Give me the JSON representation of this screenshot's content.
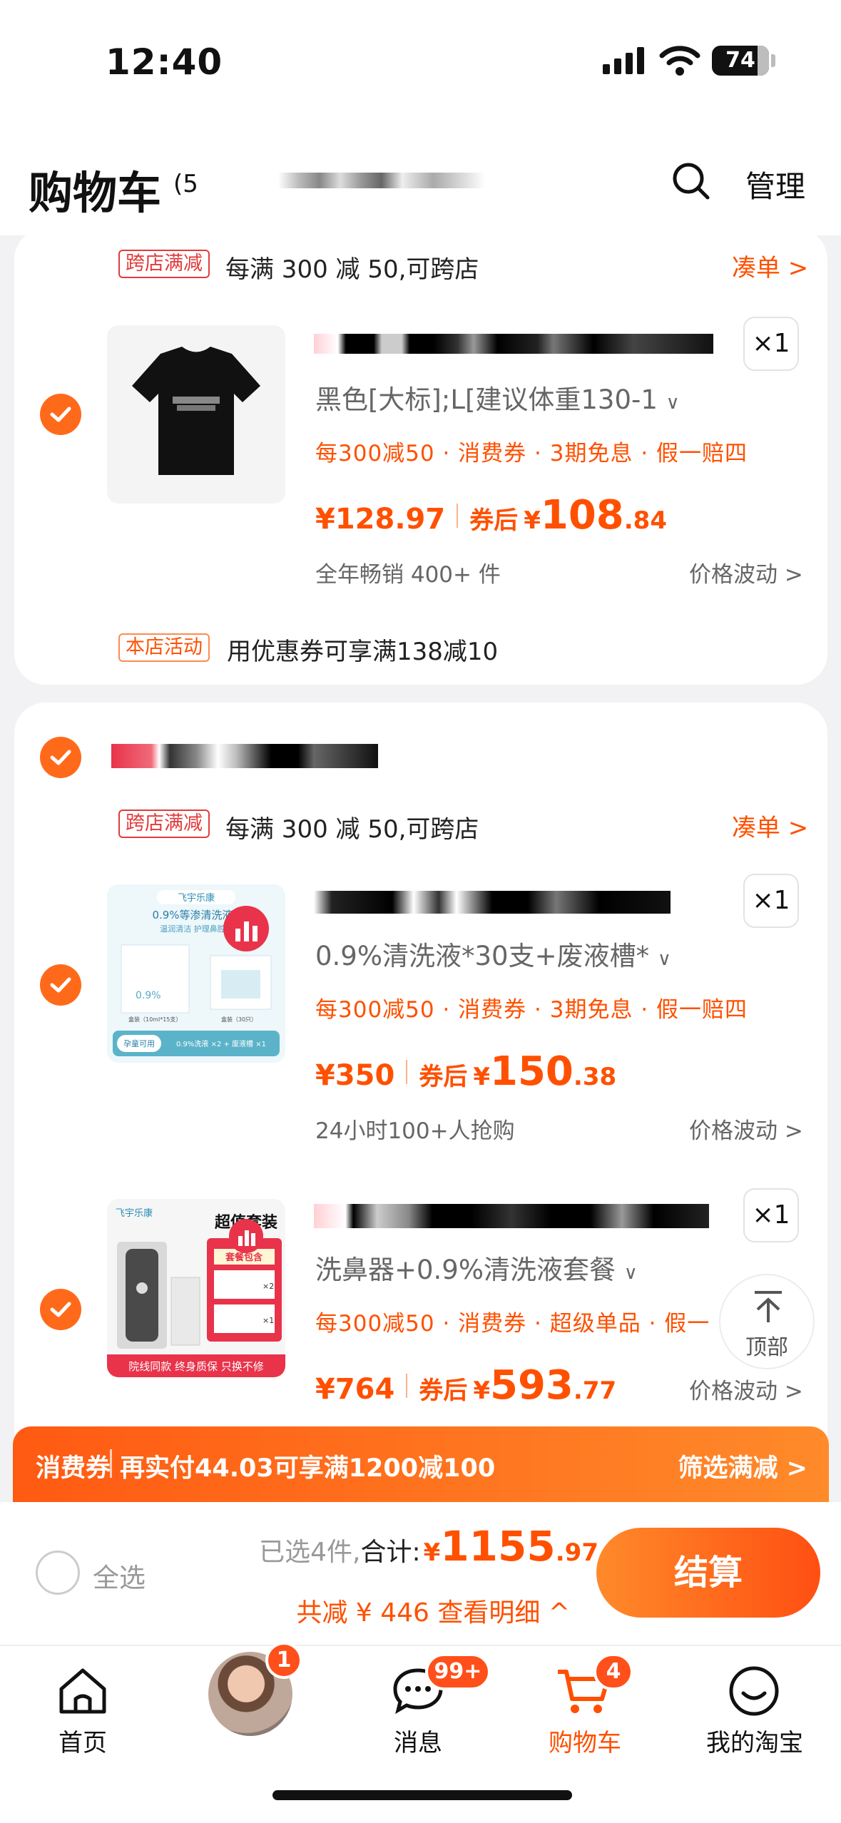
{
  "status_bar": {
    "time": "12:40",
    "battery": "74"
  },
  "header": {
    "title": "购物车",
    "count": "(5",
    "manage": "管理"
  },
  "promo_cross_store": {
    "tag": "跨店满减",
    "text": "每满 300 减 50,可跨店",
    "link": "凑单 >"
  },
  "items": [
    {
      "spec": "黑色[大标];L[建议体重130-1",
      "benefits": "每300减50 · 消费券 · 3期免息 · 假一赔四",
      "price": "¥128.97",
      "after_label": "券后",
      "yen": "¥",
      "after_int": "108",
      "after_dec": ".84",
      "sales": "全年畅销 400+ 件",
      "fluct": "价格波动 >",
      "qty": "×1"
    },
    {
      "spec": "0.9%清洗液*30支+废液槽*",
      "benefits": "每300减50 · 消费券 · 3期免息 · 假一赔四",
      "price": "¥350",
      "after_label": "券后",
      "yen": "¥",
      "after_int": "150",
      "after_dec": ".38",
      "sales": "24小时100+人抢购",
      "fluct": "价格波动 >",
      "qty": "×1"
    },
    {
      "spec": "洗鼻器+0.9%清洗液套餐",
      "benefits": "每300减50 · 消费券 · 超级单品 · 假一",
      "price": "¥764",
      "after_label": "券后",
      "yen": "¥",
      "after_int": "593",
      "after_dec": ".77",
      "fluct": "价格波动 >",
      "qty": "×1"
    }
  ],
  "store_activity": {
    "tag": "本店活动",
    "text": "用优惠券可享满138减10"
  },
  "product_images": {
    "brand": "飞宇乐康",
    "img2_lines": [
      "0.9%等渗清洗液",
      "温润清洁  护理鼻腔",
      "0.9%",
      "盒装（10ml*15支）",
      "盒装（30只）",
      "孕童可用",
      "0.9%洗液 ×2 + 废液槽 ×1"
    ],
    "img3_lines": [
      "超值套装",
      "套餐包含",
      "×2",
      "×1",
      "院线同款 终身质保 只换不修"
    ]
  },
  "back_to_top": "顶部",
  "coupon_bar": {
    "label": "消费券",
    "text": "再实付44.03可享满1200减100",
    "link": "筛选满减 >"
  },
  "checkout": {
    "select_all": "全选",
    "selected": "已选4件,",
    "total_label": "合计:",
    "yen": "¥",
    "total_int": "1155",
    "total_dec": ".97",
    "reduce": "共减 ¥ 446  查看明细 ^",
    "pay": "结算"
  },
  "tabs": [
    {
      "label": "首页"
    },
    {
      "label": "",
      "badge": "1"
    },
    {
      "label": "消息",
      "badge": "99+"
    },
    {
      "label": "购物车",
      "badge": "4"
    },
    {
      "label": "我的淘宝"
    }
  ],
  "colors": {
    "accent": "#ff5000",
    "tag_red": "#e23b3b",
    "check": "#ff6a1a"
  }
}
